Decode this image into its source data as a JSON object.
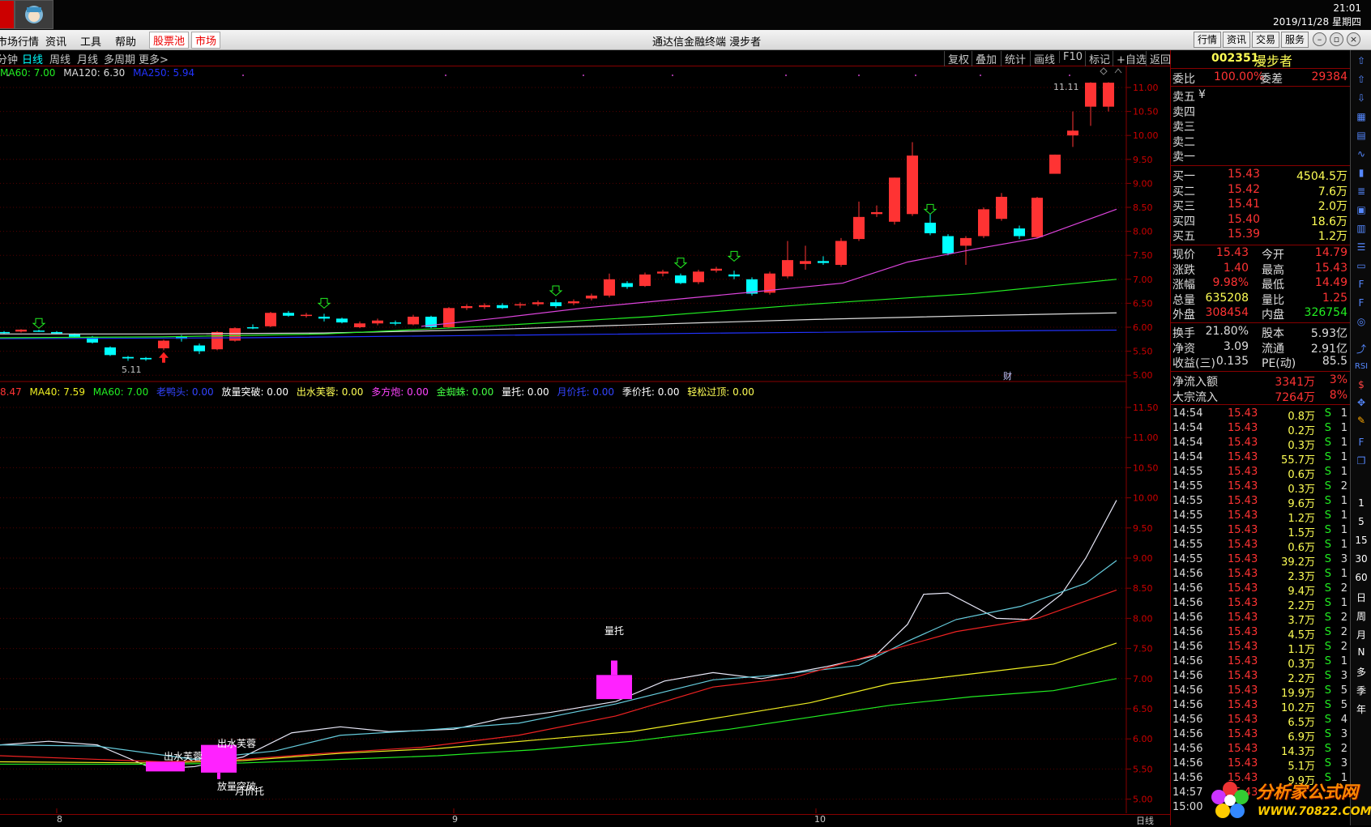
{
  "topbar": {
    "time": "21:01",
    "date": "2019/11/28 星期四"
  },
  "menu": {
    "items": [
      "市场行情",
      "资讯",
      "工具",
      "帮助"
    ],
    "red_items": [
      "股票池",
      "市场"
    ],
    "title": "通达信金融终端  漫步者",
    "right_buttons": [
      "行情",
      "资讯",
      "交易",
      "服务"
    ]
  },
  "period": {
    "items": [
      "分钟",
      "日线",
      "周线",
      "月线",
      "多周期",
      "更多>"
    ],
    "selected": "日线",
    "tools": [
      "复权",
      "叠加",
      "统计",
      "画线",
      "F10",
      "标记",
      "+自选",
      "返回"
    ]
  },
  "upper_legend": [
    {
      "text": "MA60: 7.00",
      "color": "#22ee22"
    },
    {
      "text": "MA120: 6.30",
      "color": "#dddddd"
    },
    {
      "text": "MA250: 5.94",
      "color": "#2233ff"
    }
  ],
  "upper_axis": [
    "11.00",
    "10.50",
    "10.00",
    "9.50",
    "9.00",
    "8.50",
    "8.00",
    "7.50",
    "7.00",
    "6.50",
    "6.00",
    "5.50",
    "5.00"
  ],
  "upper_annotations": {
    "high": "11.11",
    "low": "5.11",
    "cai": "财"
  },
  "lower_legend": [
    {
      "text": "8.47",
      "color": "#ff3333"
    },
    {
      "text": "MA40: 7.59",
      "color": "#eeee22"
    },
    {
      "text": "MA60: 7.00",
      "color": "#22ee22"
    },
    {
      "text": "老鸭头: 0.00",
      "color": "#3344ff"
    },
    {
      "text": "放量突破: 0.00",
      "color": "#ffffff"
    },
    {
      "text": "出水芙蓉: 0.00",
      "color": "#ffff55"
    },
    {
      "text": "多方炮: 0.00",
      "color": "#ff44ff"
    },
    {
      "text": "金蜘蛛: 0.00",
      "color": "#44ff44"
    },
    {
      "text": "量托: 0.00",
      "color": "#ffffff"
    },
    {
      "text": "月价托: 0.00",
      "color": "#3344ff"
    },
    {
      "text": "季价托: 0.00",
      "color": "#ffffff"
    },
    {
      "text": "轻松过顶: 0.00",
      "color": "#ffff55"
    }
  ],
  "lower_axis": [
    "11.50",
    "11.00",
    "10.50",
    "10.00",
    "9.50",
    "9.00",
    "8.50",
    "8.00",
    "7.50",
    "7.00",
    "6.50",
    "6.00",
    "5.50",
    "5.00"
  ],
  "lower_annotations": {
    "liangtuo": "量托",
    "chushui1": "出水芙蓉",
    "chushui2": "出水芙蓉",
    "fangliang": "放量突破",
    "yuejia": "月价托"
  },
  "xaxis": [
    "8",
    "9",
    "10",
    "日线"
  ],
  "quote": {
    "code": "002351",
    "name": "漫步者",
    "weibi_label": "委比",
    "weibi": "100.00%",
    "weicha_label": "委差",
    "weicha": "29384",
    "sell": [
      {
        "label": "卖五",
        "extra": "¥"
      },
      {
        "label": "卖四",
        "extra": ""
      },
      {
        "label": "卖三",
        "extra": ""
      },
      {
        "label": "卖二",
        "extra": ""
      },
      {
        "label": "卖一",
        "extra": ""
      }
    ],
    "buy": [
      {
        "label": "买一",
        "price": "15.43",
        "vol": "4504.5万"
      },
      {
        "label": "买二",
        "price": "15.42",
        "vol": "7.6万"
      },
      {
        "label": "买三",
        "price": "15.41",
        "vol": "2.0万"
      },
      {
        "label": "买四",
        "price": "15.40",
        "vol": "18.6万"
      },
      {
        "label": "买五",
        "price": "15.39",
        "vol": "1.2万"
      }
    ],
    "stats": [
      {
        "l1": "现价",
        "v1": "15.43",
        "c1": "#ff3333",
        "l2": "今开",
        "v2": "14.79",
        "c2": "#ff3333"
      },
      {
        "l1": "涨跌",
        "v1": "1.40",
        "c1": "#ff3333",
        "l2": "最高",
        "v2": "15.43",
        "c2": "#ff3333"
      },
      {
        "l1": "涨幅",
        "v1": "9.98%",
        "c1": "#ff3333",
        "l2": "最低",
        "v2": "14.49",
        "c2": "#ff3333"
      },
      {
        "l1": "总量",
        "v1": "635208",
        "c1": "#ffff55",
        "l2": "量比",
        "v2": "1.25",
        "c2": "#ff3333"
      },
      {
        "l1": "外盘",
        "v1": "308454",
        "c1": "#ff3333",
        "l2": "内盘",
        "v2": "326754",
        "c2": "#22ee22"
      }
    ],
    "stats2": [
      {
        "l1": "换手",
        "v1": "21.80%",
        "l2": "股本",
        "v2": "5.93亿"
      },
      {
        "l1": "净资",
        "v1": "3.09",
        "l2": "流通",
        "v2": "2.91亿"
      },
      {
        "l1": "收益(三)",
        "v1": "0.135",
        "l2": "PE(动)",
        "v2": "85.5"
      }
    ],
    "flow": [
      {
        "label": "净流入额",
        "v": "3341万",
        "pct": "3%"
      },
      {
        "label": "大宗流入",
        "v": "7264万",
        "pct": "8%"
      }
    ],
    "ticks": [
      [
        "14:54",
        "15.43",
        "0.8万",
        "S",
        "1"
      ],
      [
        "14:54",
        "15.43",
        "0.2万",
        "S",
        "1"
      ],
      [
        "14:54",
        "15.43",
        "0.3万",
        "S",
        "1"
      ],
      [
        "14:54",
        "15.43",
        "55.7万",
        "S",
        "1"
      ],
      [
        "14:55",
        "15.43",
        "0.6万",
        "S",
        "1"
      ],
      [
        "14:55",
        "15.43",
        "0.3万",
        "S",
        "2"
      ],
      [
        "14:55",
        "15.43",
        "9.6万",
        "S",
        "1"
      ],
      [
        "14:55",
        "15.43",
        "1.2万",
        "S",
        "1"
      ],
      [
        "14:55",
        "15.43",
        "1.5万",
        "S",
        "1"
      ],
      [
        "14:55",
        "15.43",
        "0.6万",
        "S",
        "1"
      ],
      [
        "14:55",
        "15.43",
        "39.2万",
        "S",
        "3"
      ],
      [
        "14:56",
        "15.43",
        "2.3万",
        "S",
        "1"
      ],
      [
        "14:56",
        "15.43",
        "9.4万",
        "S",
        "2"
      ],
      [
        "14:56",
        "15.43",
        "2.2万",
        "S",
        "1"
      ],
      [
        "14:56",
        "15.43",
        "3.7万",
        "S",
        "2"
      ],
      [
        "14:56",
        "15.43",
        "4.5万",
        "S",
        "2"
      ],
      [
        "14:56",
        "15.43",
        "1.1万",
        "S",
        "2"
      ],
      [
        "14:56",
        "15.43",
        "0.3万",
        "S",
        "1"
      ],
      [
        "14:56",
        "15.43",
        "2.2万",
        "S",
        "3"
      ],
      [
        "14:56",
        "15.43",
        "19.9万",
        "S",
        "5"
      ],
      [
        "14:56",
        "15.43",
        "10.2万",
        "S",
        "5"
      ],
      [
        "14:56",
        "15.43",
        "6.5万",
        "S",
        "4"
      ],
      [
        "14:56",
        "15.43",
        "6.9万",
        "S",
        "3"
      ],
      [
        "14:56",
        "15.43",
        "14.3万",
        "S",
        "2"
      ],
      [
        "14:56",
        "15.43",
        "5.1万",
        "S",
        "3"
      ],
      [
        "14:56",
        "15.43",
        "9.9万",
        "S",
        "1"
      ],
      [
        "14:57",
        "15.43",
        "",
        "",
        ""
      ],
      [
        "15:00",
        "",
        "",
        "",
        ""
      ]
    ]
  },
  "sidebar": {
    "labels": [
      "1",
      "5",
      "15",
      "30",
      "60",
      "日",
      "周",
      "月",
      "N",
      "多",
      "季",
      "年"
    ],
    "rsi": "RSI"
  },
  "watermark": {
    "line1": "分析家公式网",
    "line2": "WWW.70822.COM"
  }
}
